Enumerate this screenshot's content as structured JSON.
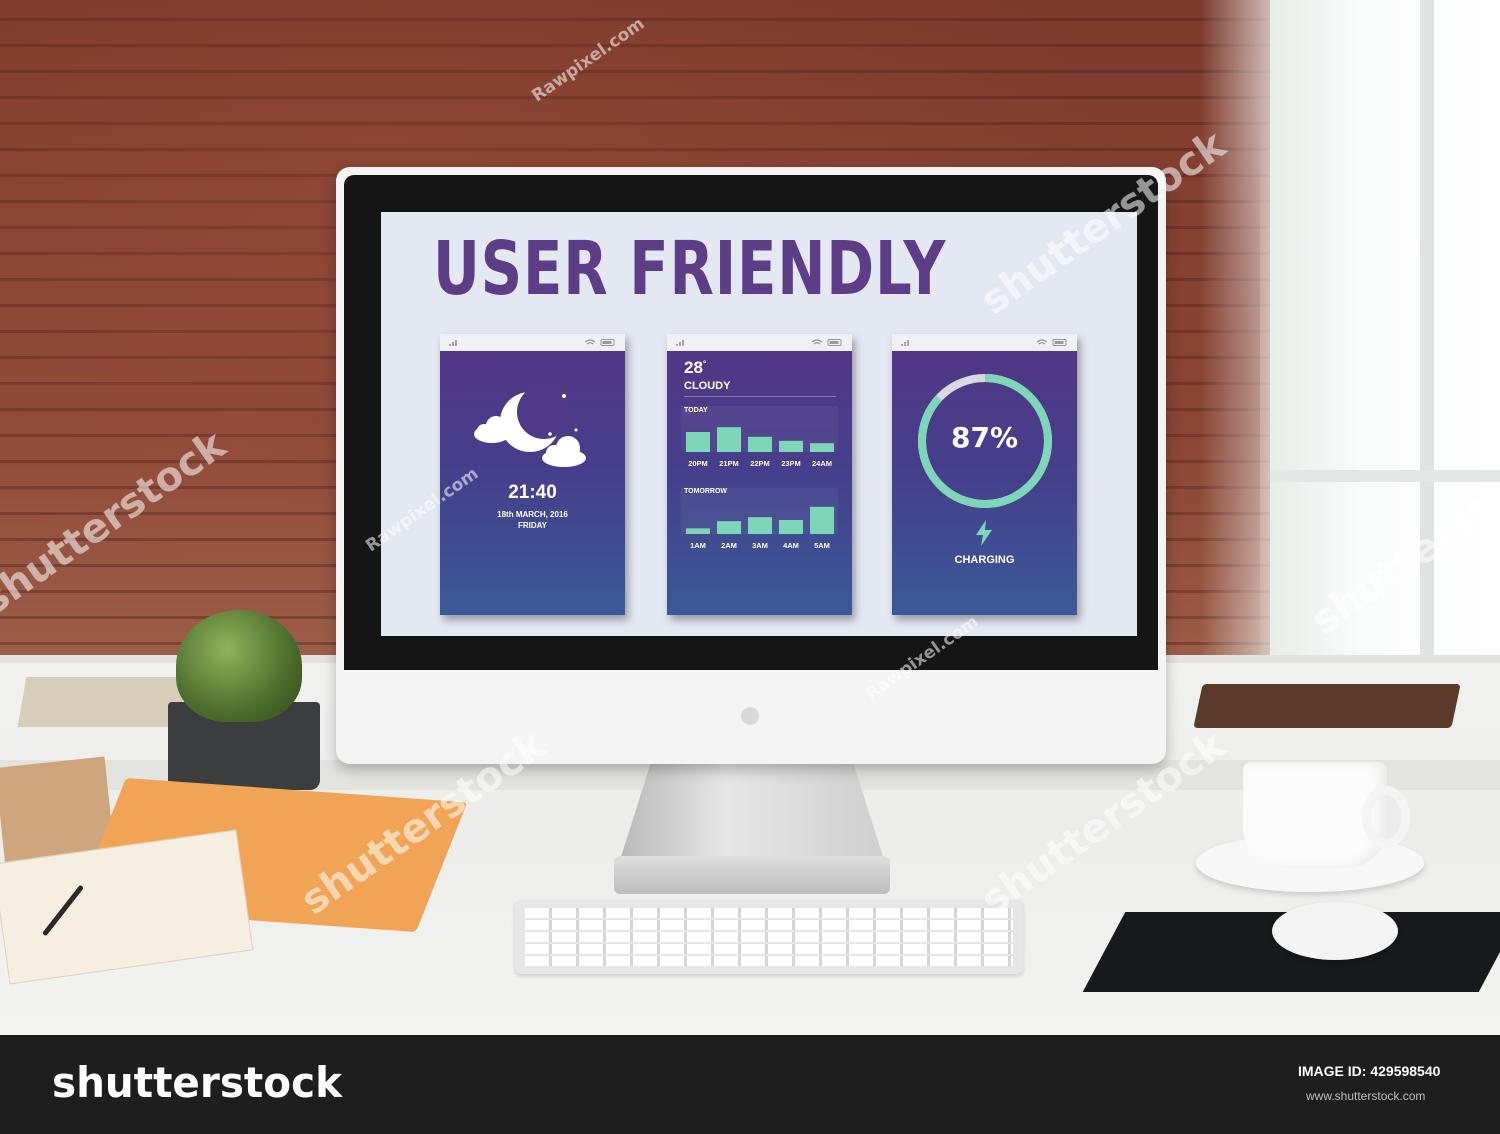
{
  "screen": {
    "headline": "USER FRIENDLY",
    "accent_color": "#5d3c88",
    "bar_color": "#7ed6b8"
  },
  "card_clock": {
    "icon": "moon-clouds-icon",
    "time": "21:40",
    "date": "18th MARCH, 2016",
    "day": "FRIDAY"
  },
  "card_weather": {
    "temperature": "28",
    "degree": "°",
    "condition": "CLOUDY",
    "today_label": "TODAY",
    "tomorrow_label": "TOMORROW",
    "today": {
      "times": [
        "20PM",
        "21PM",
        "22PM",
        "23PM",
        "24AM"
      ],
      "levels": [
        0.5,
        0.62,
        0.38,
        0.28,
        0.22
      ]
    },
    "tomorrow": {
      "times": [
        "1AM",
        "2AM",
        "3AM",
        "4AM",
        "5AM"
      ],
      "levels": [
        0.14,
        0.32,
        0.42,
        0.35,
        0.68
      ]
    }
  },
  "card_battery": {
    "percent_label": "87%",
    "level": 0.87,
    "status": "CHARGING",
    "icon": "lightning-bolt-icon"
  },
  "watermarks": {
    "shutterstock": "shutterstock",
    "rawpixel": "Rawpixel.com"
  },
  "footer": {
    "logo_text": "shutterstock",
    "image_id": "IMAGE ID: 429598540",
    "url": "www.shutterstock.com"
  }
}
